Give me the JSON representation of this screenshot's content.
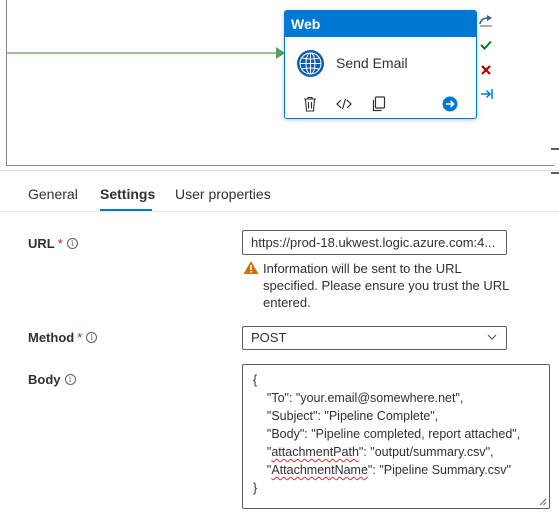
{
  "canvas": {
    "activity": {
      "type_label": "Web",
      "name": "Send Email",
      "icons": [
        "globe-icon",
        "delete-icon",
        "code-icon",
        "copy-icon",
        "go-arrow-icon"
      ]
    },
    "side_icons": [
      "redo-arrow-icon",
      "success-check-icon",
      "failure-x-icon",
      "completion-arrow-icon"
    ],
    "colors": {
      "accent": "#0078d4",
      "connector": "#5aa05a",
      "success": "#107c10",
      "failure": "#a80000"
    }
  },
  "tabs": [
    {
      "label": "General",
      "active": false
    },
    {
      "label": "Settings",
      "active": true
    },
    {
      "label": "User properties",
      "active": false
    }
  ],
  "form": {
    "url": {
      "label": "URL",
      "required_mark": "*",
      "value": "https://prod-18.ukwest.logic.azure.com:4...",
      "warning": "Information will be sent to the URL specified. Please ensure you trust the URL entered."
    },
    "method": {
      "label": "Method",
      "required_mark": "*",
      "value": "POST"
    },
    "body": {
      "label": "Body",
      "lines": [
        "{",
        "    \"To\": \"your.email@somewhere.net\",",
        "    \"Subject\": \"Pipeline Complete\",",
        "    \"Body\": \"Pipeline completed, report attached\",",
        "    \"attachmentPath\": \"output/summary.csv\",",
        "    \"AttachmentName\": \"Pipeline Summary.csv\"",
        "}"
      ]
    }
  }
}
